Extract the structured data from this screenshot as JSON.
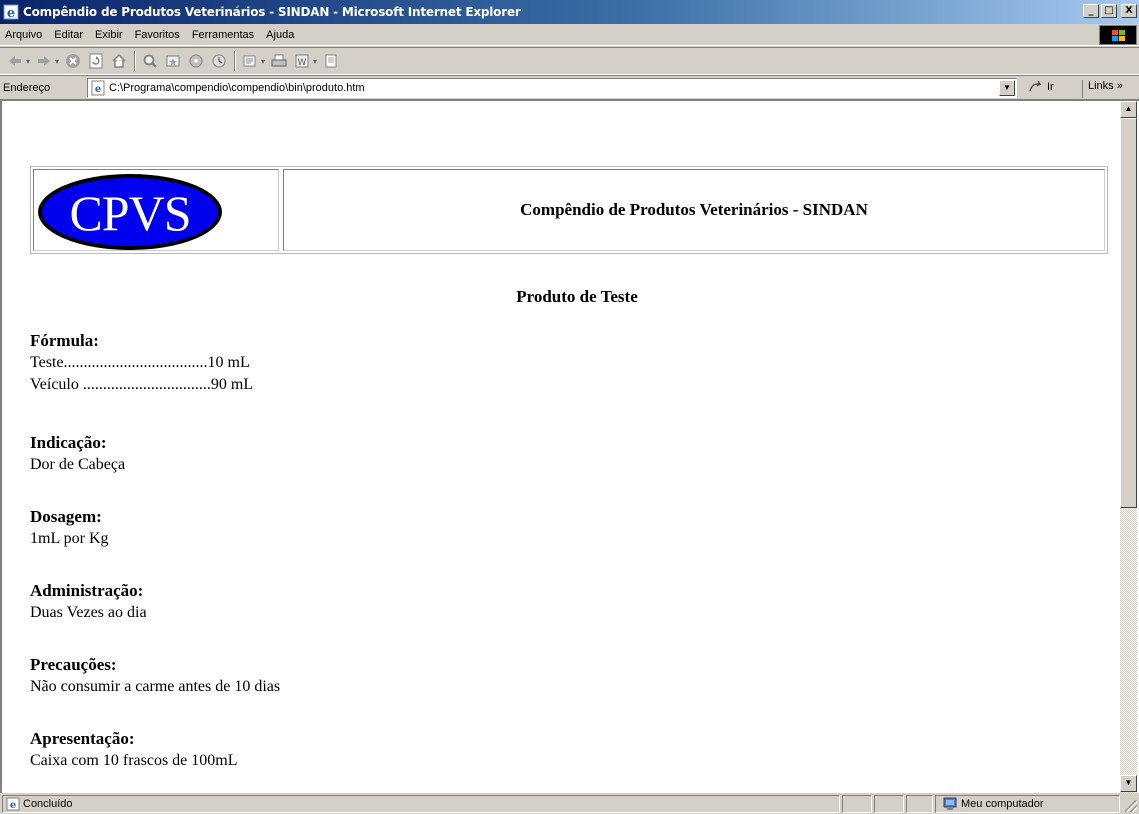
{
  "window": {
    "title": "Compêndio de Produtos Veterinários - SINDAN - Microsoft Internet Explorer",
    "buttons": {
      "minimize": "_",
      "maximize": "□",
      "close": "X"
    }
  },
  "menu": {
    "items": [
      "Arquivo",
      "Editar",
      "Exibir",
      "Favoritos",
      "Ferramentas",
      "Ajuda"
    ]
  },
  "toolbar": {
    "buttons": [
      "back-icon",
      "forward-icon",
      "stop-icon",
      "refresh-icon",
      "home-icon",
      "search-icon",
      "favorites-icon",
      "media-icon",
      "history-icon",
      "mail-icon",
      "print-icon",
      "edit-icon",
      "discuss-icon"
    ]
  },
  "address": {
    "label": "Endereço",
    "url": "C:\\Programa\\compendio\\compendio\\bin\\produto.htm",
    "go_label": "Ir",
    "links_label": "Links »"
  },
  "page": {
    "logo_text": "CPVS",
    "logo_colors": {
      "fill": "#0000ee",
      "outline": "#000000"
    },
    "header_title": "Compêndio de Produtos Veterinários - SINDAN",
    "product_title": "Produto de Teste",
    "sections": [
      {
        "heading": "Fórmula:",
        "lines": [
          "Teste....................................10 mL",
          "Veículo ................................90 mL"
        ]
      },
      {
        "heading": "Indicação:",
        "lines": [
          "Dor de Cabeça"
        ]
      },
      {
        "heading": "Dosagem:",
        "lines": [
          "1mL por Kg"
        ]
      },
      {
        "heading": "Administração:",
        "lines": [
          "Duas Vezes ao dia"
        ]
      },
      {
        "heading": "Precauções:",
        "lines": [
          "Não consumir a carme antes de 10 dias"
        ]
      },
      {
        "heading": "Apresentação:",
        "lines": [
          "Caixa com 10 frascos de 100mL"
        ]
      }
    ]
  },
  "status": {
    "text": "Concluído",
    "zone": "Meu computador"
  }
}
